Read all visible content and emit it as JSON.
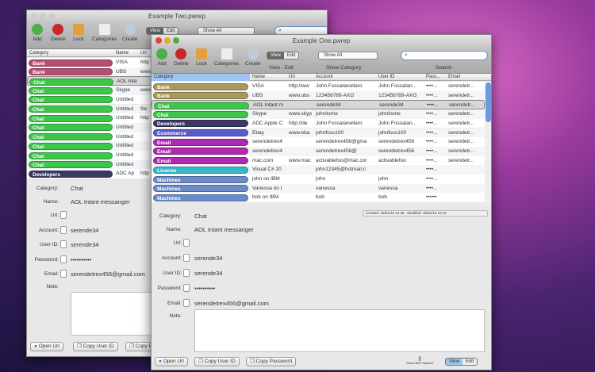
{
  "colors": {
    "Bank_back": "#b84e6e",
    "Bank": "#a89a5c",
    "Chat": "#3ec64a",
    "Developers": "#3a3a66",
    "Ecommerce": "#5a5ac8",
    "Email": "#b02ab0",
    "License": "#3ab8c8",
    "Machines": "#6a8ac8"
  },
  "toolbar": {
    "add": "Add",
    "delete": "Delete",
    "lock": "Lock",
    "categories": "Categories",
    "create": "Create",
    "view": "View",
    "edit": "Edit",
    "view_edit": "View - Edit",
    "show_all": "Show All",
    "show_category": "Show Category",
    "search": "Search"
  },
  "back": {
    "title": "Example Two.pwrep",
    "headers": [
      "Category",
      "Name",
      "Url"
    ],
    "rows": [
      [
        "Bank",
        "VISA",
        "http"
      ],
      [
        "Bank",
        "UBS",
        "www"
      ],
      [
        "Chat",
        "AOL Inta",
        ""
      ],
      [
        "Chat",
        "Skype",
        "www"
      ],
      [
        "Chat",
        "Untitled",
        ""
      ],
      [
        "Chat",
        "Untitled",
        "file"
      ],
      [
        "Chat",
        "Untitled",
        "http"
      ],
      [
        "Chat",
        "Untitled",
        ""
      ],
      [
        "Chat",
        "Untitled",
        ""
      ],
      [
        "Chat",
        "Untitled",
        ""
      ],
      [
        "Chat",
        "Untitled",
        ""
      ],
      [
        "Chat",
        "Untitled",
        ""
      ],
      [
        "Developers",
        "ADC Ap",
        "http"
      ]
    ],
    "details": {
      "category_label": "Category:",
      "category": "Chat",
      "name_label": "Name:",
      "name": "AOL Intant messanger",
      "url_label": "Url:",
      "account_label": "Account:",
      "account": "serende34",
      "userid_label": "User ID:",
      "userid": "serende34",
      "password_label": "Password:",
      "password": "••••••••••",
      "email_label": "Email:",
      "email": "serendetrex456@gmail.com",
      "note_label": "Note:"
    },
    "buttons": {
      "open_url": "Open Url",
      "copy_user": "Copy User ID",
      "copy_pass": "Copy P"
    }
  },
  "front": {
    "title": "Example One.pwrep",
    "headers": [
      "Category",
      "Name",
      "Url",
      "Account",
      "User ID",
      "Pass...",
      "Email"
    ],
    "rows": [
      [
        "Bank",
        "VISA",
        "http://ww",
        "John Fossatanellaro",
        "John Fossatan...",
        "••••...",
        "serendetr..."
      ],
      [
        "Bank",
        "UBS",
        "www.ubs",
        "123456789-AXG",
        "123456789-AXG",
        "••••...",
        "serendetr..."
      ],
      [
        "Chat",
        "AOL Intant m",
        "",
        "serende34",
        "serende34",
        "••••...",
        "serendetr..."
      ],
      [
        "Chat",
        "Skype",
        "www.skyp",
        "johnitsme",
        "johnitsme",
        "••••...",
        "serendetr..."
      ],
      [
        "Developers",
        "ADC Apple C",
        "http://de",
        "John Fossatanellaro",
        "John Fossatan...",
        "••••...",
        "serendetr..."
      ],
      [
        "Ecommerce",
        "Ebay",
        "www.eba",
        "johnfoss100",
        "johnfoss100",
        "••••...",
        "serendetr..."
      ],
      [
        "Email",
        "serendetrex4",
        "",
        "serendetrex456@gma",
        "serendetrex456",
        "••••...",
        "serendetr..."
      ],
      [
        "Email",
        "serendetrex4",
        "",
        "serendetrex456@",
        "serendetrex456",
        "••••...",
        "serendetr..."
      ],
      [
        "Email",
        "mac.com",
        "www.mac",
        "activablefoo@mac.cor",
        "activablefoo",
        "••••...",
        "serendetr..."
      ],
      [
        "License",
        "Visual C# 20",
        "",
        "john12345@hotmail.c",
        "",
        "••••...",
        ""
      ],
      [
        "Machines",
        "john on IBM",
        "",
        "john",
        "john",
        "••••...",
        ""
      ],
      [
        "Machines",
        "Vanessa on I",
        "",
        "vanessa",
        "vanessa",
        "••••...",
        ""
      ],
      [
        "Machines",
        "bob on IBM",
        "",
        "bob",
        "bob",
        "••••••",
        ""
      ]
    ],
    "created": "Created: 18/01/10 13.36",
    "modified": "Modified: 18/01/10 13.37",
    "details": {
      "category_label": "Category:",
      "category": "Chat",
      "name_label": "Name:",
      "name": "AOL Intant messanger",
      "url_label": "Url:",
      "account_label": "Account:",
      "account": "serende34",
      "userid_label": "User ID:",
      "userid": "serende34",
      "password_label": "Password:",
      "password": "••••••••••",
      "email_label": "Email:",
      "email": "serendetrex456@gmail.com",
      "note_label": "Note:"
    },
    "buttons": {
      "open_url": "Open Url",
      "copy_user": "Copy User ID",
      "copy_pass": "Copy Password",
      "show_hide": "Show-Hide Password",
      "view": "View",
      "edit": "Edit"
    }
  }
}
